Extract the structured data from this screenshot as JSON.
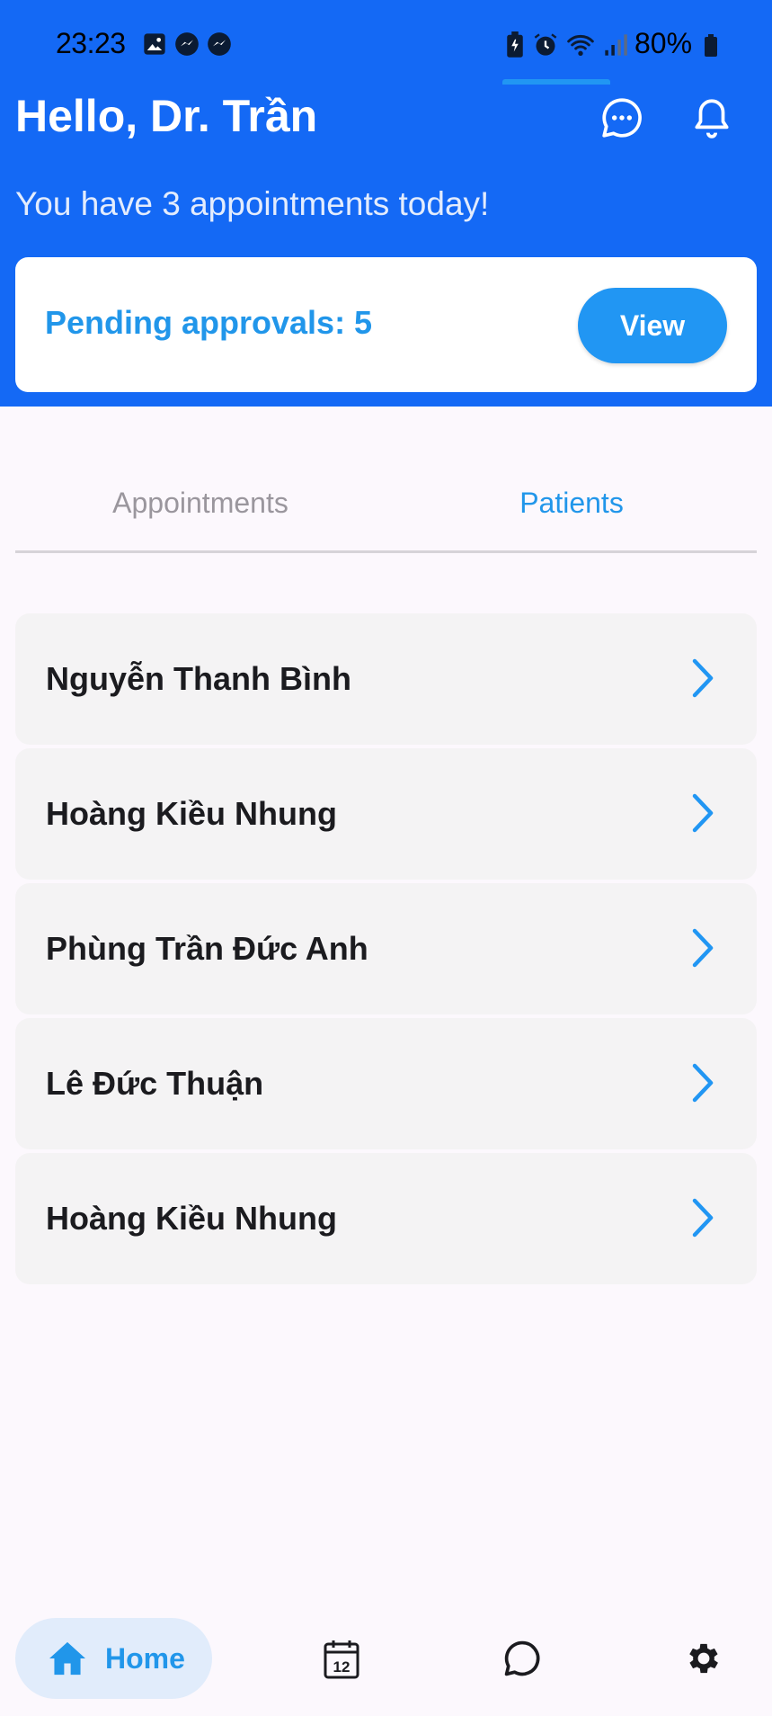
{
  "status_bar": {
    "time": "23:23",
    "battery": "80%",
    "left_icons": [
      "gallery-icon",
      "messenger-icon",
      "messenger-icon"
    ],
    "right_icons": [
      "battery-saver-icon",
      "alarm-icon",
      "wifi-icon",
      "signal-icon"
    ]
  },
  "header": {
    "greeting": "Hello, Dr. Trần",
    "subtitle": "You have 3 appointments today!",
    "icons": [
      "chat-icon",
      "bell-icon"
    ]
  },
  "pending": {
    "text": "Pending approvals: 5",
    "button": "View"
  },
  "tabs": {
    "items": [
      "Appointments",
      "Patients"
    ],
    "active": "Patients"
  },
  "patients": [
    {
      "name": "Nguyễn Thanh Bình"
    },
    {
      "name": "Hoàng Kiều Nhung"
    },
    {
      "name": "Phùng Trần Đức Anh"
    },
    {
      "name": "Lê Đức Thuận"
    },
    {
      "name": "Hoàng Kiều Nhung"
    }
  ],
  "bottom_nav": {
    "home_label": "Home",
    "calendar_day": "12",
    "icons": [
      "home-icon",
      "calendar-icon",
      "chat-bubble-icon",
      "gear-icon"
    ]
  },
  "colors": {
    "header_bg": "#1469f5",
    "accent": "#2196f3",
    "page_bg": "#fcf8fd",
    "list_item_bg": "#f4f3f4"
  }
}
